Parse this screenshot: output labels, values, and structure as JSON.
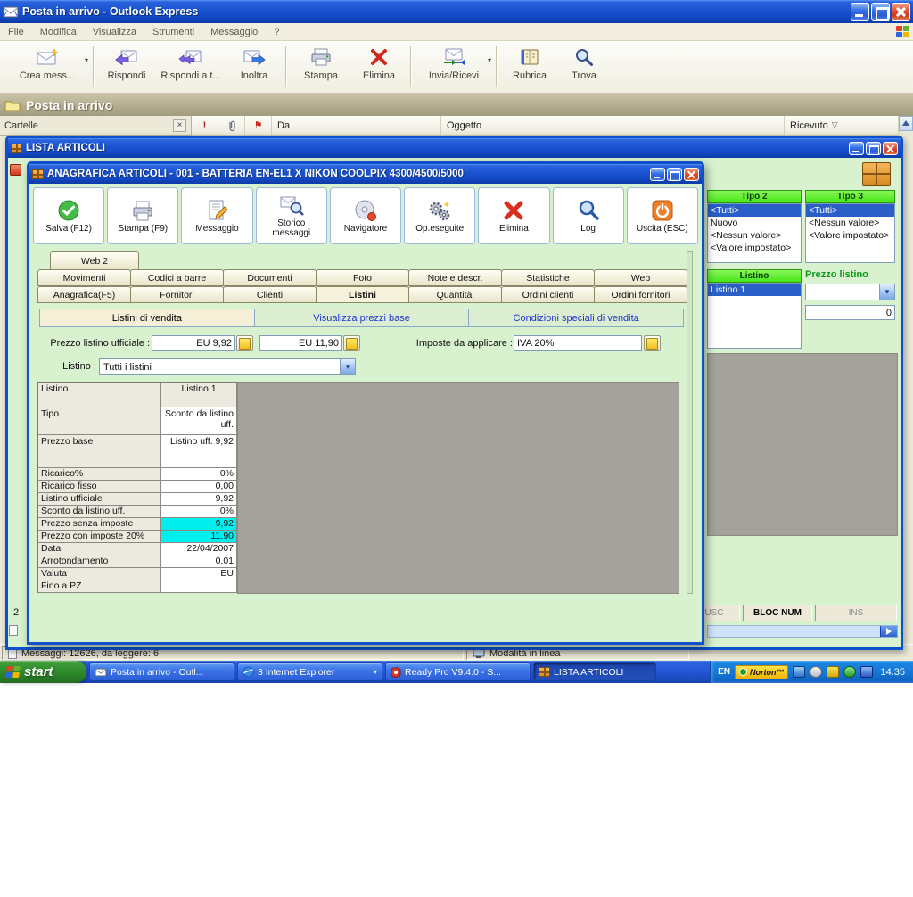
{
  "icons": {
    "dropdown": "▾",
    "sort_desc": "▽",
    "priority": "!",
    "flag": "⚑",
    "close_small": "×"
  },
  "oe": {
    "title": "Posta in arrivo - Outlook Express",
    "menu": [
      "File",
      "Modifica",
      "Visualizza",
      "Strumenti",
      "Messaggio",
      "?"
    ],
    "toolbar": [
      {
        "label": "Crea mess..."
      },
      {
        "label": "Rispondi"
      },
      {
        "label": "Rispondi a t..."
      },
      {
        "label": "Inoltra"
      },
      {
        "label": "Stampa"
      },
      {
        "label": "Elimina"
      },
      {
        "label": "Invia/Ricevi"
      },
      {
        "label": "Rubrica"
      },
      {
        "label": "Trova"
      }
    ],
    "banner": "Posta in arrivo",
    "folders_label": "Cartelle",
    "columns": {
      "da": "Da",
      "oggetto": "Oggetto",
      "ricevuto": "Ricevuto"
    },
    "status_left": "Messaggi: 12626, da leggere: 6",
    "status_right": "Modalità in linea"
  },
  "lista": {
    "title": "LISTA ARTICOLI",
    "tipo2": {
      "header": "Tipo 2",
      "items": [
        "<Tutti>",
        "Nuovo",
        "<Nessun valore>",
        "<Valore impostato>"
      ]
    },
    "tipo3": {
      "header": "Tipo 3",
      "items": [
        "<Tutti>",
        "<Nessun valore>",
        "<Valore impostato>"
      ]
    },
    "listino_panel": {
      "header": "Listino",
      "items": [
        "Listino 1"
      ]
    },
    "prezzo_listino_label": "Prezzo listino",
    "prezzo_listino_value": "0",
    "keyboard": {
      "maiusc": "MAIUSC",
      "bloc_num": "BLOC NUM",
      "ins": "INS"
    },
    "remnant_count": "2"
  },
  "dialog": {
    "title": "ANAGRAFICA ARTICOLI - 001 - BATTERIA EN-EL1 X NIKON COOLPIX 4300/4500/5000",
    "toolbar": [
      "Salva (F12)",
      "Stampa (F9)",
      "Messaggio",
      "Storico messaggi",
      "Navigatore",
      "Op.eseguite",
      "Elimina",
      "Log",
      "Uscita (ESC)"
    ],
    "tab_web2": "Web 2",
    "tabs_row1": [
      "Movimenti",
      "Codici a barre",
      "Documenti",
      "Foto",
      "Note e descr.",
      "Statistiche",
      "Web"
    ],
    "tabs_row2": [
      "Anagrafica(F5)",
      "Fornitori",
      "Clienti",
      "Listini",
      "Quantità'",
      "Ordini clienti",
      "Ordini fornitori"
    ],
    "inner_tabs": [
      "Listini di vendita",
      "Visualizza prezzi base",
      "Condizioni speciali di vendita"
    ],
    "fields": {
      "prezzo_listino_label": "Prezzo listino ufficiale :",
      "prezzo_listino_1": "EU 9,92",
      "prezzo_listino_2": "EU 11,90",
      "imposte_label": "Imposte da applicare :",
      "imposte_value": "IVA 20%",
      "listino_label": "Listino :",
      "listino_value": "Tutti i listini"
    },
    "table": {
      "col1_header": "Listino",
      "col2_header": "Listino 1",
      "rows": [
        {
          "label": "Tipo",
          "value": "Sconto da listino uff."
        },
        {
          "label": "Prezzo base",
          "value": "Listino uff. 9,92"
        },
        {
          "label": "Ricarico%",
          "value": "0%"
        },
        {
          "label": "Ricarico fisso",
          "value": "0,00"
        },
        {
          "label": "Listino ufficiale",
          "value": "9,92"
        },
        {
          "label": "Sconto da listino uff.",
          "value": "0%"
        },
        {
          "label": "Prezzo senza imposte",
          "value": "9,92"
        },
        {
          "label": "Prezzo con imposte 20%",
          "value": "11,90"
        },
        {
          "label": "Data",
          "value": "22/04/2007"
        },
        {
          "label": "Arrotondamento",
          "value": "0,01"
        },
        {
          "label": "Valuta",
          "value": "EU"
        },
        {
          "label": "Fino a PZ",
          "value": ""
        }
      ]
    }
  },
  "taskbar": {
    "start_label": "start",
    "tasks": [
      {
        "label": "Posta in arrivo - Outl..."
      },
      {
        "label": "3 Internet Explorer"
      },
      {
        "label": "Ready Pro V9.4.0 - S..."
      },
      {
        "label": "LISTA ARTICOLI"
      }
    ],
    "tray": {
      "language": "EN",
      "norton": "Norton™",
      "time": "14.35"
    }
  }
}
